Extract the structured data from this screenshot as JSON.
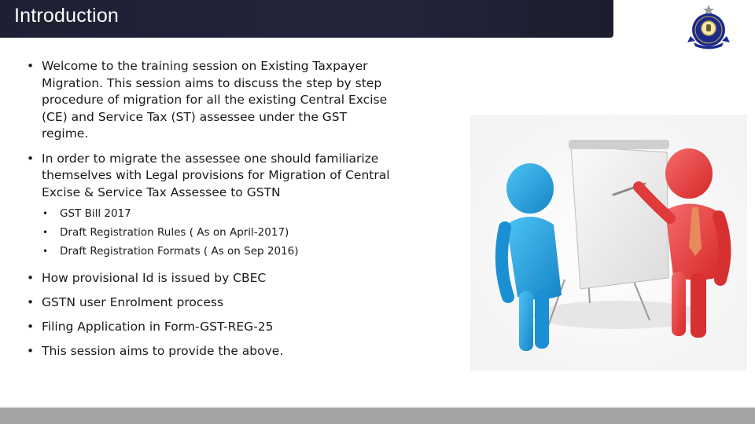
{
  "header": {
    "title": "Introduction",
    "logo_icon": "cbec-emblem-icon"
  },
  "content": {
    "bullets": [
      {
        "text": "Welcome to the training session on Existing Taxpayer Migration. This session aims to discuss the step by step procedure of migration for all the existing Central Excise (CE) and Service Tax (ST) assessee under the GST regime."
      },
      {
        "text": "In order to migrate the assessee one should familiarize themselves with Legal provisions for Migration of Central Excise & Service Tax Assessee to GSTN"
      }
    ],
    "sub_bullets": [
      "GST Bill 2017",
      "Draft Registration Rules ( As on April-2017)",
      "Draft Registration Formats ( As on Sep 2016)"
    ],
    "more_bullets": [
      "How provisional Id is issued by CBEC",
      "GSTN  user Enrolment process",
      "Filing Application in Form-GST-REG-25",
      "This session aims to provide the above."
    ],
    "bullet_glyph": "•"
  },
  "illustration": {
    "icon": "presenter-flipchart-illustration-icon",
    "colors": {
      "blue_figure": "#1fa3e0",
      "red_figure": "#e83a3a",
      "board": "#f2f2f2"
    }
  },
  "colors": {
    "title_bar": "#1e1f33",
    "footer_bar": "#a4a4a4",
    "emblem_blue": "#1b2a8c"
  }
}
